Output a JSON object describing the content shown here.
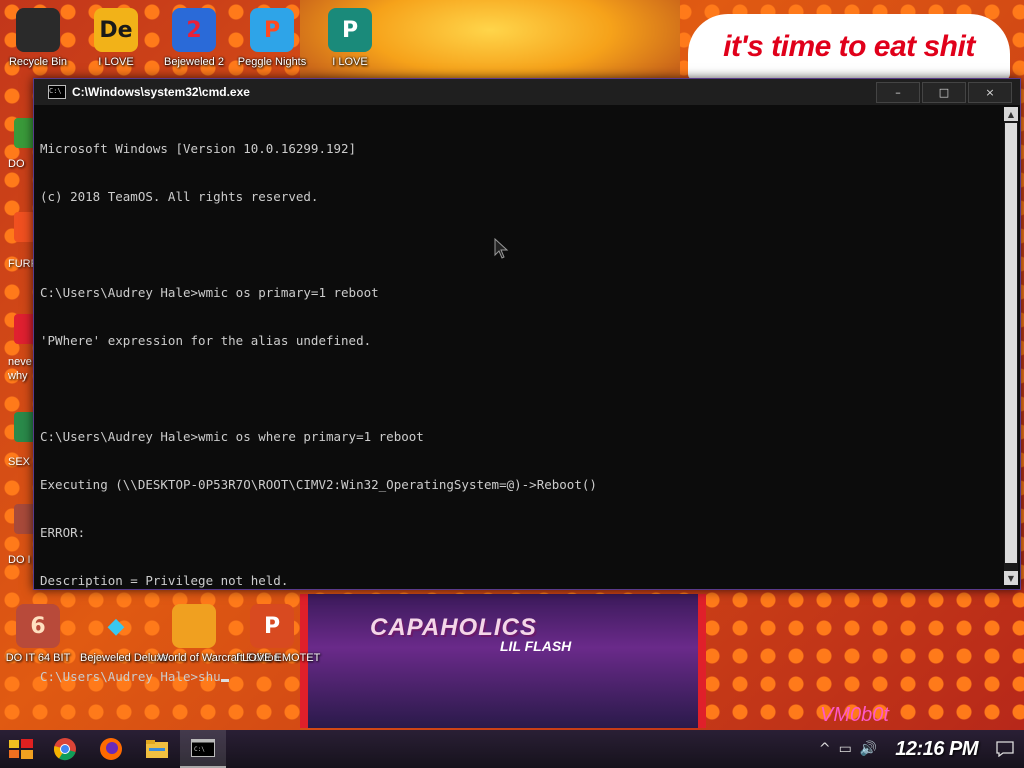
{
  "desktop": {
    "top_icons": [
      {
        "label": "Recycle Bin",
        "icon": "recycle-bin-icon",
        "glyph": "",
        "bg": "#2a2a2a",
        "fg": "#e8e8e8"
      },
      {
        "label": "I LOVE",
        "icon": "de-app-icon",
        "glyph": "De",
        "bg": "#f2b218",
        "fg": "#1a1a1a"
      },
      {
        "label": "Bejeweled 2",
        "icon": "bejeweled-2-icon",
        "glyph": "2",
        "bg": "#2a6ad8",
        "fg": "#e8203a"
      },
      {
        "label": "Peggle Nights",
        "icon": "peggle-nights-icon",
        "glyph": "P",
        "bg": "#2ea4e8",
        "fg": "#ff4a20"
      },
      {
        "label": "I LOVE",
        "icon": "publisher-icon",
        "glyph": "P",
        "bg": "#1a8a7a",
        "fg": "#ffffff"
      }
    ],
    "side_labels": [
      "DO",
      "FURR",
      "neve",
      "why",
      "SEX",
      "DO I"
    ],
    "bottom_icons": [
      {
        "label": "DO IT 64 BIT",
        "icon": "portrait-icon",
        "glyph": "6",
        "bg": "#b84a3a",
        "fg": "#ffe0c0"
      },
      {
        "label": "Bejeweled Deluxe",
        "icon": "bejeweled-deluxe-icon",
        "glyph": "◆",
        "bg": "transparent",
        "fg": "#38c8f0"
      },
      {
        "label": "World of Warcraft Edition",
        "icon": "world-of-icon",
        "glyph": "",
        "bg": "#f0a020",
        "fg": "#ffffff"
      },
      {
        "label": "I LOVE EMOTET",
        "icon": "powerpoint-icon",
        "glyph": "P",
        "bg": "#d84a20",
        "fg": "#ffffff"
      }
    ],
    "speech_text": "it's time to eat shit",
    "album_title": "CAPAHOLICS",
    "album_sub": "LIL FLASH",
    "vm_label": "VM0b0t"
  },
  "window": {
    "title": "C:\\Windows\\system32\\cmd.exe",
    "minimize": "–",
    "maximize": "□",
    "close": "×",
    "console_lines": [
      "Microsoft Windows [Version 10.0.16299.192]",
      "(c) 2018 TeamOS. All rights reserved.",
      "",
      "C:\\Users\\Audrey Hale>wmic os primary=1 reboot",
      "'PWhere' expression for the alias undefined.",
      "",
      "C:\\Users\\Audrey Hale>wmic os where primary=1 reboot",
      "Executing (\\\\DESKTOP-0P53R7O\\ROOT\\CIMV2:Win32_OperatingSystem=@)->Reboot()",
      "ERROR:",
      "Description = Privilege not held.",
      ""
    ],
    "prompt_line": "C:\\Users\\Audrey Hale>shu"
  },
  "taskbar": {
    "items": [
      "start-icon",
      "chrome-icon",
      "firefox-icon",
      "file-explorer-icon",
      "cmd-icon"
    ],
    "clock": "12:16 PM",
    "tray": [
      "^",
      "▭",
      "🔊"
    ]
  }
}
